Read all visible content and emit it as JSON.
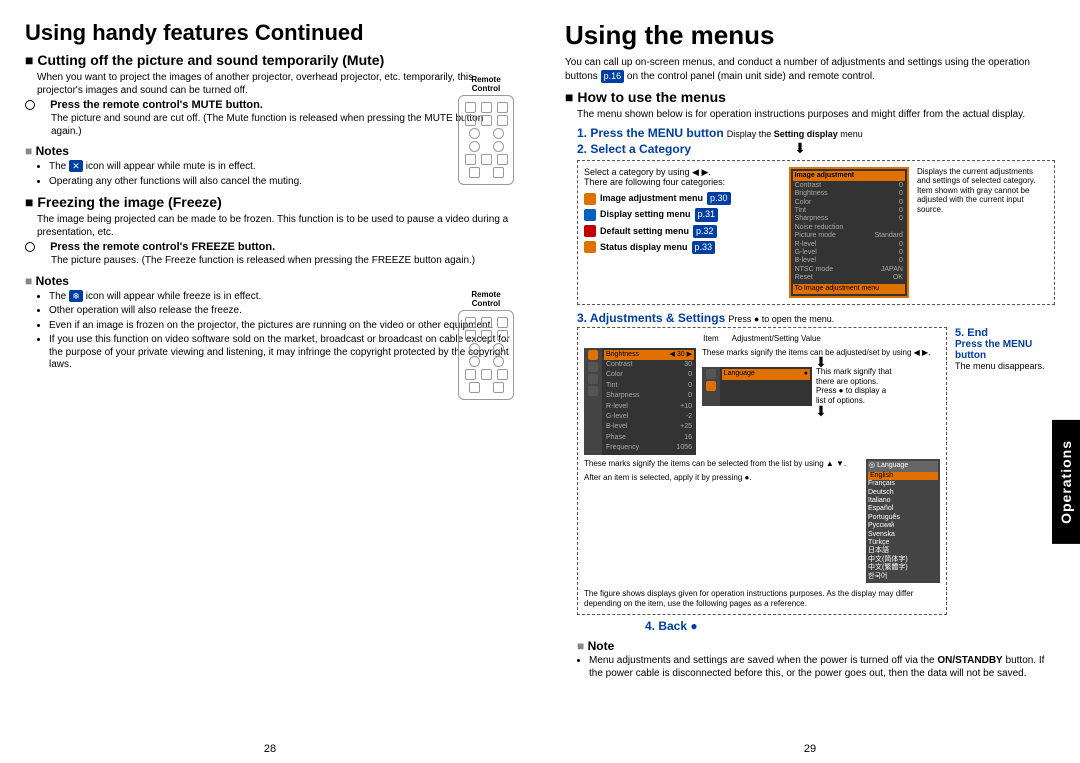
{
  "left": {
    "title": "Using handy features Continued",
    "s1": {
      "heading": "Cutting off the picture and sound temporarily (Mute)",
      "intro": "When you want to project the images of another projector, overhead projector, etc. temporarily, this projector's images and sound can be turned off.",
      "step": "Press the remote control's MUTE button.",
      "step_desc": "The picture and sound are cut off. (The Mute function is released when pressing the MUTE button again.)",
      "notes_h": "Notes",
      "note1a": "The ",
      "note1b": " icon will appear while mute is in effect.",
      "note2": "Operating any other functions will also cancel the muting.",
      "remote_label": "Remote Control"
    },
    "s2": {
      "heading": "Freezing the image (Freeze)",
      "intro": "The image being projected can be made to be frozen. This function is to be used to pause a video during a presentation, etc.",
      "step": "Press the remote control's FREEZE button.",
      "step_desc": "The picture pauses. (The Freeze function is released when pressing the FREEZE button again.)",
      "notes_h": "Notes",
      "note1a": "The ",
      "note1b": " icon will appear while freeze is in effect.",
      "note2": "Other operation will also release the freeze.",
      "note3": "Even if an image is frozen on the projector, the pictures are running on the video or other equipment.",
      "note4": "If you use this function on video software sold on the market, broadcast or broadcast on cable except for the purpose of your private viewing and listening, it may infringe the copyright protected by the copyright laws.",
      "remote_label": "Remote Control"
    },
    "pagenum": "28"
  },
  "right": {
    "title": "Using the menus",
    "intro_a": "You can call up on-screen menus, and conduct a number of adjustments and settings using the operation buttons ",
    "intro_b": " on the control panel (main unit side) and remote control.",
    "pref_intro": "p.16",
    "howto_h": "How to use the menus",
    "howto_intro": "The menu shown below is for operation instructions purposes and might differ from the actual display.",
    "step1": "1. Press the MENU button",
    "step1_sub": "Display the Setting display menu",
    "step2": "2. Select a Category",
    "step3": "3. Adjustments & Settings",
    "step3_sub": "Press ● to open the menu.",
    "step4": "4. Back ●",
    "step5": "5. End",
    "step5_sub": "Press the MENU button",
    "step5_desc": "The menu disappears.",
    "cat": {
      "intro": "Select a category by using ◀ ▶.",
      "intro2": "There are following four categories:",
      "m1": "Image adjustment menu",
      "m2": "Display setting menu",
      "m3": "Default setting menu",
      "m4": "Status display menu",
      "p1": "p.30",
      "p2": "p.31",
      "p3": "p.32",
      "p4": "p.33",
      "right_text": "Displays the current adjustments and settings of selected category.\nItem shown with gray cannot be adjusted with the current input source."
    },
    "adj": {
      "item_label": "Item",
      "value_label": "Adjustment/Setting Value",
      "callout1": "These marks signify the items can be adjusted/set by using ◀ ▶.",
      "callout2": "This mark signify that there are options. Press ● to display a list of options.",
      "callout3": "These marks signify the items can be selected from the list by using ▲ ▼.",
      "callout4": "After an item is selected, apply it by pressing ●.",
      "footnote": "The figure shows displays given for operation instructions purposes. As the display may differ depending on the item, use the following pages as a reference."
    },
    "osd_items": {
      "hdr": "Image adjustment",
      "r1": "Contrast",
      "r2": "Brightness",
      "r3": "Color",
      "r4": "Tint",
      "r5": "Sharpness",
      "r6": "Noise reduction",
      "r7": "Picture mode",
      "r7v": "Standard",
      "r8": "R-level",
      "r9": "G-level",
      "r10": "B-level",
      "r11": "NTSC mode",
      "r11v": "JAPAN",
      "r12": "Reset",
      "r12v": "OK",
      "foot": "To Image adjustment menu"
    },
    "lang": {
      "hdr": "Language",
      "l1": "English",
      "l2": "Français",
      "l3": "Deutsch",
      "l4": "Italiano",
      "l5": "Español",
      "l6": "Português",
      "l7": "Русский",
      "l8": "Svenska",
      "l9": "Türkçe",
      "l10": "日本語",
      "l11": "中文(简体字)",
      "l12": "中文(繁體字)",
      "l13": "한국어"
    },
    "note_h": "Note",
    "note_text": "Menu adjustments and settings are saved when the power is turned off via the ON/STANDBY button. If the power cable is disconnected before this, or the power goes out, then the data will not be saved.",
    "sidetab": "Operations",
    "pagenum": "29"
  }
}
